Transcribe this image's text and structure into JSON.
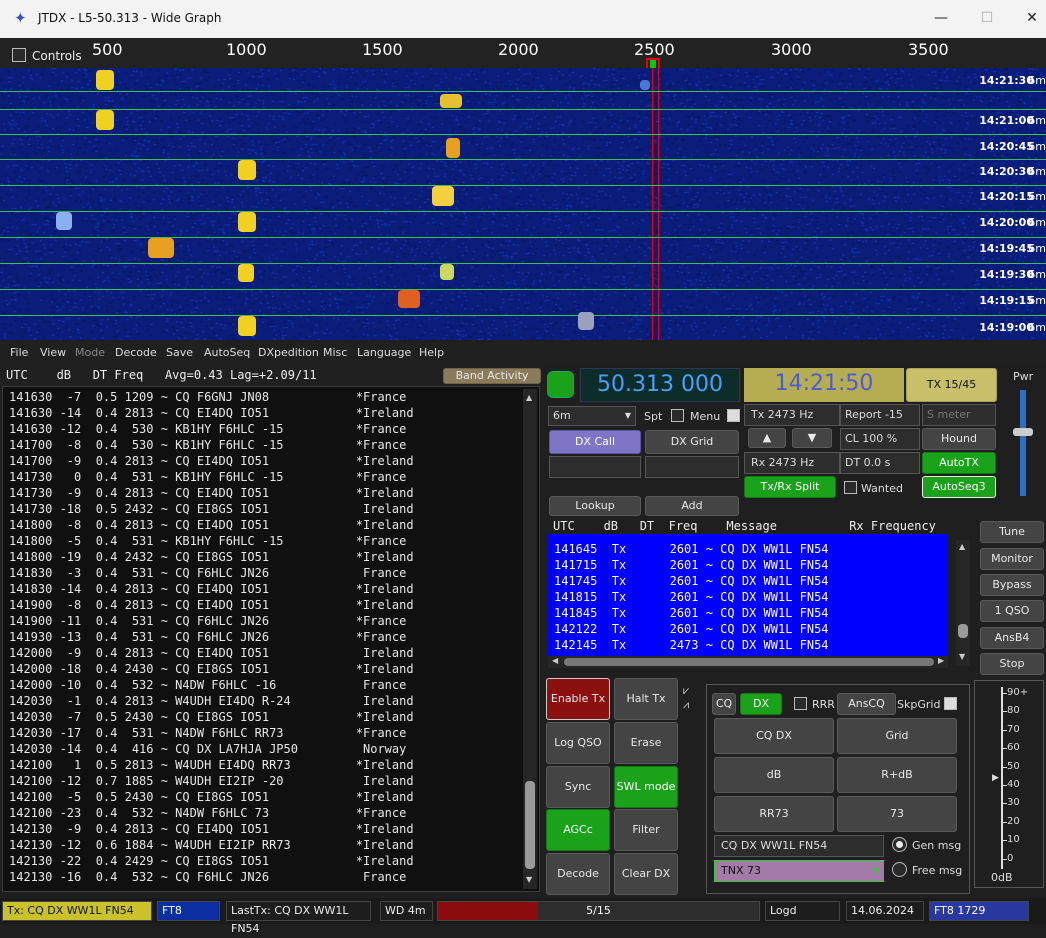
{
  "window": {
    "title": "JTDX - L5-50.313 - Wide Graph",
    "min_icon": "minimize-icon",
    "max_icon": "maximize-icon",
    "close_icon": "close-icon"
  },
  "wide_graph": {
    "controls_label": "Controls",
    "freq_ticks": [
      "500",
      "1000",
      "1500",
      "2000",
      "2500",
      "3000",
      "3500"
    ],
    "timestamps": [
      "14:21:30",
      "14:21:00",
      "14:20:45",
      "14:20:30",
      "14:20:15",
      "14:20:00",
      "14:19:45",
      "14:19:30",
      "14:19:15",
      "14:19:00"
    ],
    "band_label": "6m"
  },
  "menu": [
    "File",
    "View",
    "Mode",
    "Decode",
    "Save",
    "AutoSeq",
    "DXpedition",
    "Misc",
    "Language",
    "Help"
  ],
  "left_header": {
    "text": "UTC    dB   DT Freq   Avg=0.43 Lag=+2.09/11",
    "band_activity": "Band Activity"
  },
  "decodes": [
    "141630  -7  0.5 1209 ~ CQ F6GNJ JN08            *France",
    "141630 -14  0.4 2813 ~ CQ EI4DQ IO51            *Ireland",
    "141630 -12  0.4  530 ~ KB1HY F6HLC -15          *France",
    "141700  -8  0.4  530 ~ KB1HY F6HLC -15          *France",
    "141700  -9  0.4 2813 ~ CQ EI4DQ IO51            *Ireland",
    "141730   0  0.4  531 ~ KB1HY F6HLC -15          *France",
    "141730  -9  0.4 2813 ~ CQ EI4DQ IO51            *Ireland",
    "141730 -18  0.5 2432 ~ CQ EI8GS IO51             Ireland",
    "141800  -8  0.4 2813 ~ CQ EI4DQ IO51            *Ireland",
    "141800  -5  0.4  531 ~ KB1HY F6HLC -15          *France",
    "141800 -19  0.4 2432 ~ CQ EI8GS IO51            *Ireland",
    "141830  -3  0.4  531 ~ CQ F6HLC JN26             France",
    "141830 -14  0.4 2813 ~ CQ EI4DQ IO51            *Ireland",
    "141900  -8  0.4 2813 ~ CQ EI4DQ IO51            *Ireland",
    "141900 -11  0.4  531 ~ CQ F6HLC JN26            *France",
    "141930 -13  0.4  531 ~ CQ F6HLC JN26            *France",
    "142000  -9  0.4 2813 ~ CQ EI4DQ IO51             Ireland",
    "142000 -18  0.4 2430 ~ CQ EI8GS IO51            *Ireland",
    "142000 -10  0.4  532 ~ N4DW F6HLC -16            France",
    "142030  -1  0.4 2813 ~ W4UDH EI4DQ R-24          Ireland",
    "142030  -7  0.5 2430 ~ CQ EI8GS IO51            *Ireland",
    "142030 -17  0.4  531 ~ N4DW F6HLC RR73          *France",
    "142030 -14  0.4  416 ~ CQ DX LA7HJA JP50         Norway",
    "142100   1  0.5 2813 ~ W4UDH EI4DQ RR73         *Ireland",
    "142100 -12  0.7 1885 ~ W4UDH EI2IP -20           Ireland",
    "142100  -5  0.5 2430 ~ CQ EI8GS IO51            *Ireland",
    "142100 -23  0.4  532 ~ N4DW F6HLC 73            *France",
    "142130  -9  0.4 2813 ~ CQ EI4DQ IO51            *Ireland",
    "142130 -12  0.6 1884 ~ W4UDH EI2IP RR73         *Ireland",
    "142130 -22  0.4 2429 ~ CQ EI8GS IO51            *Ireland",
    "142130 -16  0.4  532 ~ CQ F6HLC JN26             France"
  ],
  "top_controls": {
    "freq": "50.313 000",
    "clock": "14:21:50",
    "tx_period": "TX 15/45",
    "pwr": "Pwr",
    "band": "6m",
    "spt": "Spt",
    "menu_lbl": "Menu",
    "tx_hz": "Tx  2473  Hz",
    "report": "Report -15",
    "smeter": "S meter",
    "dx_call": "DX Call",
    "dx_grid": "DX Grid",
    "up": "▲",
    "down": "▼",
    "cl": "CL  100 %",
    "hound": "Hound",
    "rx_hz": "Rx  2473  Hz",
    "dt": "DT 0.0 s",
    "autotx": "AutoTX",
    "txrx_split": "Tx/Rx Split",
    "wanted": "Wanted",
    "autoseq3": "AutoSeq3",
    "lookup": "Lookup",
    "add": "Add"
  },
  "tx_header": "UTC    dB   DT  Freq    Message          Rx Frequency",
  "tx_rows": [
    "141645  Tx      2601 ~ CQ DX WW1L FN54",
    "141715  Tx      2601 ~ CQ DX WW1L FN54",
    "141745  Tx      2601 ~ CQ DX WW1L FN54",
    "141815  Tx      2601 ~ CQ DX WW1L FN54",
    "141845  Tx      2601 ~ CQ DX WW1L FN54",
    "142122  Tx      2601 ~ CQ DX WW1L FN54",
    "142145  Tx      2473 ~ CQ DX WW1L FN54"
  ],
  "right_buttons": [
    "Tune",
    "Monitor",
    "Bypass",
    "1 QSO",
    "AnsB4",
    "Stop"
  ],
  "action_buttons": {
    "enable_tx": "Enable Tx",
    "halt_tx": "Halt Tx",
    "log_qso": "Log QSO",
    "erase": "Erase",
    "sync": "Sync",
    "swl_mode": "SWL mode",
    "agcc": "AGCc",
    "filter": "Filter",
    "decode": "Decode",
    "clear_dx": "Clear DX"
  },
  "msg_panel": {
    "cq": "CQ",
    "dx": "DX",
    "rrr": "RRR",
    "anscq": "AnsCQ",
    "skpgrid": "SkpGrid",
    "cq_dx": "CQ DX",
    "grid": "Grid",
    "db": "dB",
    "r_db": "R+dB",
    "rr73": "RR73",
    "n73": "73",
    "gen_text": "CQ DX WW1L FN54",
    "gen_msg": "Gen msg",
    "free_text": "TNX 73",
    "free_msg": "Free msg"
  },
  "meter": {
    "labels": [
      "90+",
      "80",
      "70",
      "60",
      "50",
      "40",
      "30",
      "20",
      "10",
      "0"
    ],
    "unit": "0dB"
  },
  "status": {
    "tx_msg": "Tx: CQ DX WW1L FN54",
    "mode": "FT8",
    "last_tx": "LastTx: CQ DX WW1L FN54",
    "wd": "WD 4m",
    "progress": "5/15",
    "progress_fraction": 0.31,
    "logd": "Logd",
    "date": "14.06.2024",
    "mode_freq": "FT8   1729"
  }
}
